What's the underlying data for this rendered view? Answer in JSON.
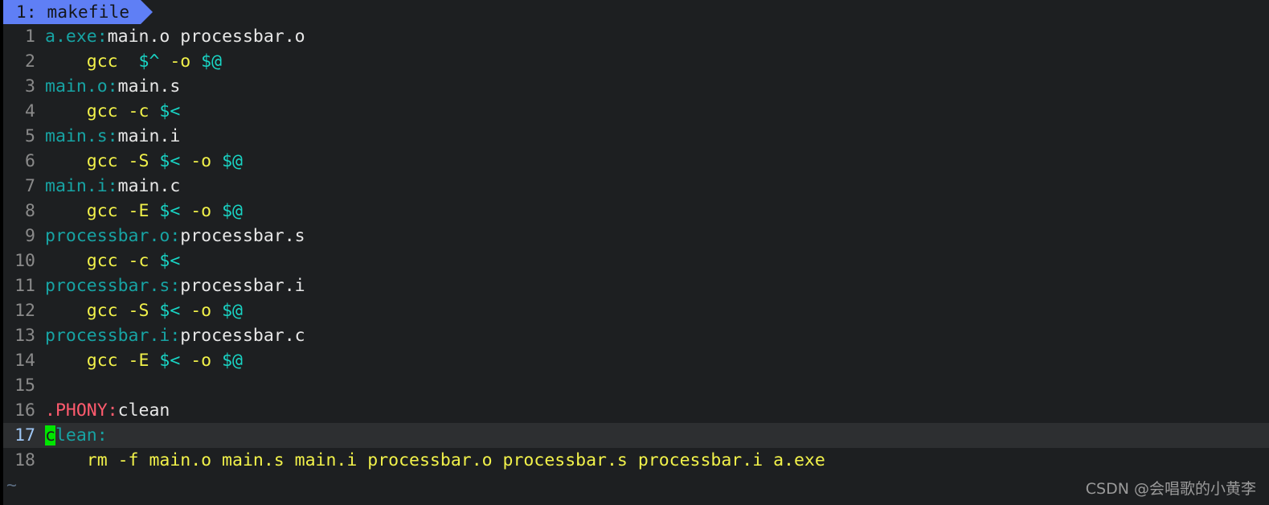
{
  "app": {
    "name": "vim",
    "background_color": "#1d1f21",
    "cursorline_color": "#2d2f31"
  },
  "tabline": {
    "tabs": [
      {
        "label": "1: makefile",
        "active": true,
        "bg_color": "#5f7ff5",
        "fg_color": "#14161a"
      }
    ]
  },
  "colors": {
    "target": "#17a3a3",
    "prereq": "#e8e8e8",
    "command": "#f2f24a",
    "autovar": "#19d6c6",
    "special_target": "#ff5b6e",
    "line_number": "#8a8a8a",
    "cursor_line_number": "#9fc7f5",
    "cursor": "#00e500",
    "tilde": "#5a6b80",
    "watermark": "#9a9a9a"
  },
  "cursor": {
    "line": 17,
    "column": 1,
    "char": "c",
    "block": true
  },
  "buffer": {
    "filename": "makefile",
    "lines": [
      {
        "number": "1",
        "cursorline": false,
        "tokens": [
          {
            "text": "a.exe",
            "class": "tok-target"
          },
          {
            "text": ":",
            "class": "tok-target"
          },
          {
            "text": "main.o processbar.o",
            "class": "tok-prereq"
          }
        ]
      },
      {
        "number": "2",
        "cursorline": false,
        "tokens": [
          {
            "text": "    gcc  ",
            "class": "tok-cmd"
          },
          {
            "text": "$^",
            "class": "tok-autovar"
          },
          {
            "text": " -o ",
            "class": "tok-cmd"
          },
          {
            "text": "$@",
            "class": "tok-autovar"
          }
        ]
      },
      {
        "number": "3",
        "cursorline": false,
        "tokens": [
          {
            "text": "main.o",
            "class": "tok-target"
          },
          {
            "text": ":",
            "class": "tok-target"
          },
          {
            "text": "main.s",
            "class": "tok-prereq"
          }
        ]
      },
      {
        "number": "4",
        "cursorline": false,
        "tokens": [
          {
            "text": "    gcc -c ",
            "class": "tok-cmd"
          },
          {
            "text": "$<",
            "class": "tok-autovar"
          }
        ]
      },
      {
        "number": "5",
        "cursorline": false,
        "tokens": [
          {
            "text": "main.s",
            "class": "tok-target"
          },
          {
            "text": ":",
            "class": "tok-target"
          },
          {
            "text": "main.i",
            "class": "tok-prereq"
          }
        ]
      },
      {
        "number": "6",
        "cursorline": false,
        "tokens": [
          {
            "text": "    gcc -S ",
            "class": "tok-cmd"
          },
          {
            "text": "$<",
            "class": "tok-autovar"
          },
          {
            "text": " -o ",
            "class": "tok-cmd"
          },
          {
            "text": "$@",
            "class": "tok-autovar"
          }
        ]
      },
      {
        "number": "7",
        "cursorline": false,
        "tokens": [
          {
            "text": "main.i",
            "class": "tok-target"
          },
          {
            "text": ":",
            "class": "tok-target"
          },
          {
            "text": "main.c",
            "class": "tok-prereq"
          }
        ]
      },
      {
        "number": "8",
        "cursorline": false,
        "tokens": [
          {
            "text": "    gcc -E ",
            "class": "tok-cmd"
          },
          {
            "text": "$<",
            "class": "tok-autovar"
          },
          {
            "text": " -o ",
            "class": "tok-cmd"
          },
          {
            "text": "$@",
            "class": "tok-autovar"
          }
        ]
      },
      {
        "number": "9",
        "cursorline": false,
        "tokens": [
          {
            "text": "processbar.o",
            "class": "tok-target"
          },
          {
            "text": ":",
            "class": "tok-target"
          },
          {
            "text": "processbar.s",
            "class": "tok-prereq"
          }
        ]
      },
      {
        "number": "10",
        "cursorline": false,
        "tokens": [
          {
            "text": "    gcc -c ",
            "class": "tok-cmd"
          },
          {
            "text": "$<",
            "class": "tok-autovar"
          }
        ]
      },
      {
        "number": "11",
        "cursorline": false,
        "tokens": [
          {
            "text": "processbar.s",
            "class": "tok-target"
          },
          {
            "text": ":",
            "class": "tok-target"
          },
          {
            "text": "processbar.i",
            "class": "tok-prereq"
          }
        ]
      },
      {
        "number": "12",
        "cursorline": false,
        "tokens": [
          {
            "text": "    gcc -S ",
            "class": "tok-cmd"
          },
          {
            "text": "$<",
            "class": "tok-autovar"
          },
          {
            "text": " -o ",
            "class": "tok-cmd"
          },
          {
            "text": "$@",
            "class": "tok-autovar"
          }
        ]
      },
      {
        "number": "13",
        "cursorline": false,
        "tokens": [
          {
            "text": "processbar.i",
            "class": "tok-target"
          },
          {
            "text": ":",
            "class": "tok-target"
          },
          {
            "text": "processbar.c",
            "class": "tok-prereq"
          }
        ]
      },
      {
        "number": "14",
        "cursorline": false,
        "tokens": [
          {
            "text": "    gcc -E ",
            "class": "tok-cmd"
          },
          {
            "text": "$<",
            "class": "tok-autovar"
          },
          {
            "text": " -o ",
            "class": "tok-cmd"
          },
          {
            "text": "$@",
            "class": "tok-autovar"
          }
        ]
      },
      {
        "number": "15",
        "cursorline": false,
        "tokens": [
          {
            "text": "",
            "class": "tok-plain"
          }
        ]
      },
      {
        "number": "16",
        "cursorline": false,
        "tokens": [
          {
            "text": ".PHONY",
            "class": "tok-special"
          },
          {
            "text": ":",
            "class": "tok-special"
          },
          {
            "text": "clean",
            "class": "tok-prereq"
          }
        ]
      },
      {
        "number": "17",
        "cursorline": true,
        "tokens": [
          {
            "text": "c",
            "class": "tok-target",
            "cursor": true
          },
          {
            "text": "lean",
            "class": "tok-target"
          },
          {
            "text": ":",
            "class": "tok-target"
          }
        ]
      },
      {
        "number": "18",
        "cursorline": false,
        "tokens": [
          {
            "text": "    rm -f main.o main.s main.i processbar.o processbar.s processbar.i a.exe",
            "class": "tok-cmd"
          }
        ]
      }
    ],
    "tildes": [
      "~"
    ]
  },
  "watermark": {
    "text": "CSDN @会唱歌的小黄李"
  }
}
